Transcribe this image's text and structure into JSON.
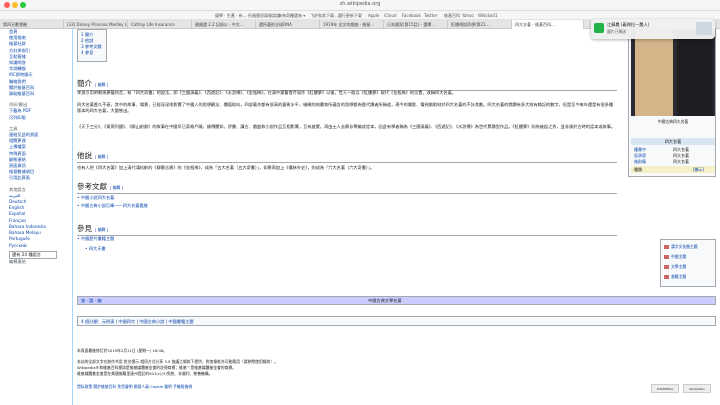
{
  "browser": {
    "url": "zh.wikipedia.org",
    "bookmarks": [
      "優學 · 生產 · 有...",
      "托福雅思填報誤誤",
      "來來奇樓選來 ▾",
      "飞驴和其下载...選行更新下载",
      "Apple",
      "iCloud",
      "Facebook",
      "Twitter",
      "維基百科",
      "Yahoo",
      "Wikidia01"
    ],
    "tabs": [
      "第四天數寶圈",
      "(33) Disney Princess Medley L...",
      "Cathay Life Insurance",
      "國國選 2.2 記錄以 - 中文...",
      "選所藝術全球DNA",
      "1919年 全文的戲曲 - 維基...",
      "日本國家(第15話) - 選擇...",
      "紅樓傳說奇想(第21...",
      "四大名著 - 維基百科..."
    ]
  },
  "sidebar": {
    "main": [
      "首頁",
      "分類索引",
      "特色內容",
      "新聞動態",
      "最近更改",
      "隨機條目",
      "資助維基百科"
    ],
    "help_head": "",
    "help": [
      "首頁",
      "使用指南",
      "維基社群",
      "方針與指引",
      "互助客棧",
      "知識問答",
      "字詞轉換",
      "IRC即時聊天",
      "聯絡我們",
      "關於維基百科",
      "資助維基百科"
    ],
    "print_head": "列印/匯出",
    "print": [
      "下載為 PDF",
      "可列印版"
    ],
    "tools_head": "工具",
    "tools": [
      "連結至此的頁面",
      "相關更改",
      "上傳檔案",
      "特殊頁面",
      "靜態連結",
      "頁面資訊",
      "維基數據項目",
      "引用此頁面",
      "維基數據項目"
    ],
    "lang_head": "其他語言",
    "langs": [
      "العربية",
      "Deutsch",
      "English",
      "Español",
      "Français",
      "Bahasa Indonesia",
      "Bahasa Melayu",
      "Português",
      "Русский"
    ],
    "more_langs": "還有 24 種語言",
    "edit_links": "編輯連結"
  },
  "toc": [
    "1 簡介",
    "2 他說",
    "3 參考文獻",
    "4 參見"
  ],
  "sections": {
    "intro_title": "簡介",
    "other_title": "他說",
    "refs_title": "參考文獻",
    "see_title": "參見",
    "edit": "[ 編輯 ]"
  },
  "paragraphs": {
    "p1": "李漁引用明朝馮夢龍所言，有「四大奇書」的說法，即《三國演義》、《西遊記》、《水滸傳》、《金瓶梅》。在清中葉曹雪芹寫作《紅樓夢》以後，世人一般以《紅樓夢》取代《金瓶梅》的位置，改稱四大名著。",
    "p2": "四大名著歷久不衰，其中的故事、場景，已經深深地影響了中國人的思想觀念、價值取向。四部著作都有很高的藝術水平，細緻的刻畫和所蘊含的思想都為歷代讀者所稱道，現今的電影、電視劇取材於四大名著的不計其數。四大名著的閱讀有多大效有賴記的數字，但是至今每年還是有很多種版本的四大名著，大量售出。",
    "p3": "《天下三分》、《東周列國》、《聊山劍劇》的故事在中國早已家喻戶曉，據傳聞知，評書、講古、戲曲和小說作品互相影響，互有啟蒙。再由士人去蕪存菁編成定本，因此有學者稱為《三國演義》、《西遊記》、《水滸傳》為世代累積型作品。《紅樓夢》則為後起之秀，並非源於古時的話本或故事。",
    "p4": "也有人把《四大名著》加上清代蒲松齡的《聊齋志異》的《金瓶梅》，成為「五大名著（五大奇書）」，如果再加上《儒林外史》，則成為「六大名著（六大奇書）」。"
  },
  "refs": [
    "中國小說四大名著",
    "中國古典小說巨峰——四大名著鑑賞"
  ],
  "see_also": [
    "中國歷代書籍主題",
    "四大天書"
  ],
  "infobox": {
    "caption": "中國古典四大名著",
    "title": "四大名著",
    "rows": [
      [
        "羅貫中",
        "四大名著"
      ],
      [
        "吳承恩",
        "四大名著"
      ],
      [
        "施耐庵",
        "四大名著"
      ]
    ],
    "last_label": "種類",
    "last_value": "[顯示]"
  },
  "portal": [
    "漢字文化圈主題",
    "中國主題",
    "文學主題",
    "書籍主題"
  ],
  "navbox": {
    "left": "查 · 論 · 編",
    "title": "中國古典文學名著"
  },
  "categories": "4 個分類：元明清 | 中國四大 | 中國古典小說 | 中國書籍主題",
  "footer": {
    "modified": "本頁面最後修訂於2019年2月11日 (星期一) 16:48。",
    "license": "本站的全部文字在創作共用 姓名標示-相同方式分享 3.0 協議之條款下提供，附加條款亦可能應用（請參閱使用條款）。",
    "trademark": "Wikipedia®和維基百科標誌是維基媒體基金會的註冊商標；維基™是維基媒體基金會的商標。",
    "nonprofit": "維基媒體基金會是在美國佛羅里達州登記的501(c)(3)免稅、非營利、慈善機構。",
    "links": "隱私政策   關於維基百科   免責聲明   開發人員   Cookie 聲明   手機版檢視"
  },
  "notification": {
    "app": "LINE",
    "title": "江蘇農 (義興拉—農人)",
    "subtitle": "圖片已傳送"
  }
}
